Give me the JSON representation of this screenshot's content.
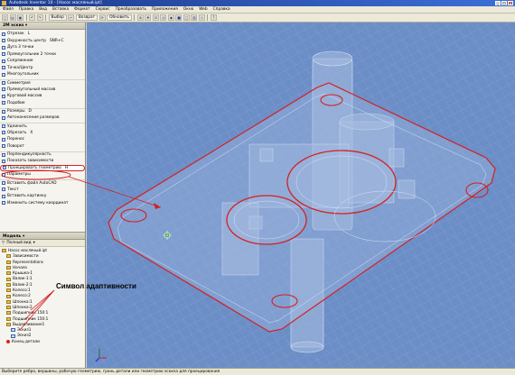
{
  "window": {
    "title": "Autodesk Inventor 10 - [Насос масляный.ipt]"
  },
  "menu": [
    "Файл",
    "Правка",
    "Вид",
    "Вставка",
    "Формат",
    "Сервис",
    "Преобразовать",
    "Приложения",
    "Окно",
    "Web",
    "Справка"
  ],
  "toolbar": {
    "select_label": "Выбор",
    "return_label": "Возврат",
    "update_label": "Обновить"
  },
  "sketch_panel": {
    "title": "2М эскиз",
    "items": [
      {
        "label": "Отрезок",
        "hotkey": "L"
      },
      {
        "label": "Окружность центр",
        "hotkey": "SNR+C"
      },
      {
        "label": "Дуга 3 точки",
        "hotkey": ""
      },
      {
        "label": "Прямоугольник 2 точки",
        "hotkey": ""
      },
      {
        "label": "Сопряжение",
        "hotkey": ""
      },
      {
        "label": "Точка/Центр",
        "hotkey": ""
      },
      {
        "label": "Многоугольник",
        "hotkey": ""
      },
      {
        "label": "Симметрия",
        "hotkey": ""
      },
      {
        "label": "Прямоугольный массив",
        "hotkey": ""
      },
      {
        "label": "Круговой массив",
        "hotkey": ""
      },
      {
        "label": "Подобие",
        "hotkey": ""
      },
      {
        "label": "Размеры",
        "hotkey": "D"
      },
      {
        "label": "Автонанесение размеров",
        "hotkey": ""
      },
      {
        "label": "Удлинить",
        "hotkey": ""
      },
      {
        "label": "Обрезать",
        "hotkey": "X"
      },
      {
        "label": "Перенос",
        "hotkey": ""
      },
      {
        "label": "Поворот",
        "hotkey": ""
      },
      {
        "label": "Перпендикулярность",
        "hotkey": ""
      },
      {
        "label": "Показать зависимости",
        "hotkey": ""
      },
      {
        "label": "Проецировать геометрию",
        "hotkey": "H"
      },
      {
        "label": "Параметры",
        "hotkey": ""
      },
      {
        "label": "Вставить файл AutoCAD",
        "hotkey": ""
      },
      {
        "label": "Текст",
        "hotkey": ""
      },
      {
        "label": "Вставить картинку",
        "hotkey": ""
      },
      {
        "label": "Изменить систему координат",
        "hotkey": ""
      }
    ]
  },
  "browser_panel": {
    "title": "Модель",
    "filter_label": "Полный вид",
    "tree": [
      {
        "label": "Насос масляный.ipt",
        "kind": "folder",
        "indent": 0
      },
      {
        "label": "Зависимости",
        "kind": "folder",
        "indent": 1
      },
      {
        "label": "Representations",
        "kind": "folder",
        "indent": 1
      },
      {
        "label": "Начало",
        "kind": "folder",
        "indent": 1
      },
      {
        "label": "Крышка-1",
        "kind": "folder",
        "indent": 1
      },
      {
        "label": "Валик-1:1",
        "kind": "folder",
        "indent": 1
      },
      {
        "label": "Валик-2:1",
        "kind": "folder",
        "indent": 1
      },
      {
        "label": "Колесо:1",
        "kind": "folder",
        "indent": 1
      },
      {
        "label": "Колесо:2",
        "kind": "folder",
        "indent": 1
      },
      {
        "label": "Шпонка:1",
        "kind": "folder",
        "indent": 1
      },
      {
        "label": "Шпонка:2",
        "kind": "folder",
        "indent": 1
      },
      {
        "label": "Подшипник 150:1",
        "kind": "folder",
        "indent": 1
      },
      {
        "label": "Подшипник 150:1",
        "kind": "folder",
        "indent": 1
      },
      {
        "label": "Выдавливание1",
        "kind": "folder",
        "indent": 1
      },
      {
        "label": "Эскиз1",
        "kind": "sketch",
        "indent": 2
      },
      {
        "label": "Эскиз2",
        "kind": "sketch",
        "indent": 2
      },
      {
        "label": "Конец детали",
        "kind": "end",
        "indent": 1
      }
    ]
  },
  "annotation": {
    "callout_text": "Символ адаптивности"
  },
  "status": {
    "text": "Выберите ребро, вершины, рабочую геометрию, грань детали или геометрию эскиза для проецирования"
  },
  "colors": {
    "viewport_bg": "#6e90c8",
    "highlight": "#d42020",
    "grid": "#9fb8e0"
  }
}
